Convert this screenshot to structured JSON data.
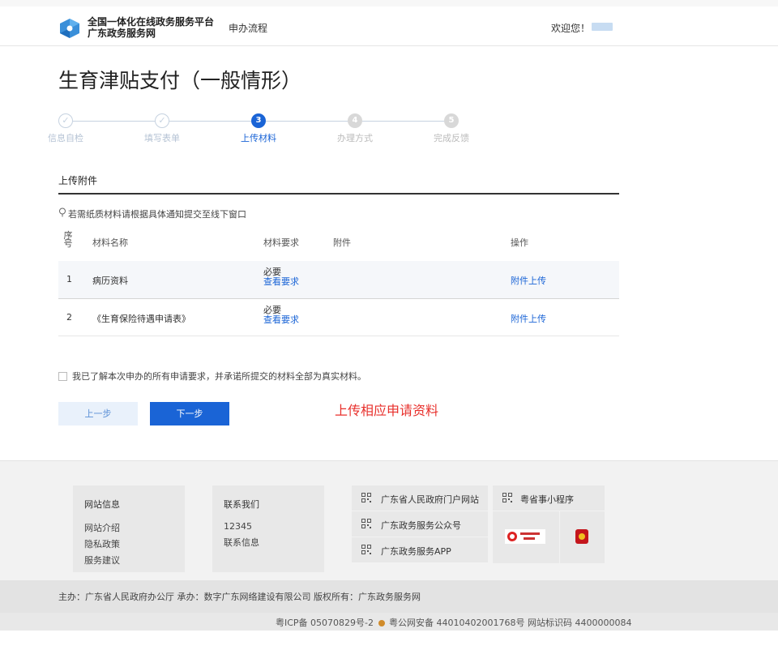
{
  "header": {
    "logo_line1": "全国一体化在线政务服务平台",
    "logo_line2": "广东政务服务网",
    "nav_process": "申办流程",
    "welcome": "欢迎您！"
  },
  "page_title": "生育津贴支付（一般情形）",
  "steps": [
    {
      "label": "信息自检",
      "mark": "✓",
      "state": "done"
    },
    {
      "label": "填写表单",
      "mark": "✓",
      "state": "done"
    },
    {
      "label": "上传材料",
      "mark": "3",
      "state": "current"
    },
    {
      "label": "办理方式",
      "mark": "4",
      "state": "todo"
    },
    {
      "label": "完成反馈",
      "mark": "5",
      "state": "todo"
    }
  ],
  "upload": {
    "section_title": "上传附件",
    "tip": "若需纸质材料请根据具体通知提交至线下窗口",
    "columns": {
      "idx_a": "序",
      "idx_b": "号",
      "name": "材料名称",
      "requirement": "材料要求",
      "attachment": "附件",
      "action": "操作"
    },
    "rows": [
      {
        "idx": "1",
        "name": "病历资料",
        "required": "必要",
        "view": "查看要求",
        "action": "附件上传"
      },
      {
        "idx": "2",
        "name": "《生育保险待遇申请表》",
        "required": "必要",
        "view": "查看要求",
        "action": "附件上传"
      }
    ]
  },
  "agreement": "我已了解本次申办的所有申请要求，并承诺所提交的材料全部为真实材料。",
  "buttons": {
    "prev": "上一步",
    "next": "下一步"
  },
  "annotation": "上传相应申请资料",
  "footer": {
    "site_info": {
      "title": "网站信息",
      "links": [
        "网站介绍",
        "隐私政策",
        "服务建议"
      ]
    },
    "contact": {
      "title": "联系我们",
      "phone": "12345",
      "info": "联系信息"
    },
    "qr_items": [
      "广东省人民政府门户网站",
      "广东政务服务公众号",
      "广东政务服务APP"
    ],
    "mini_program": "粤省事小程序",
    "sponsor_line": "主办：广东省人民政府办公厅    承办：数字广东网络建设有限公司    版权所有：广东政务服务网",
    "icp_part1": "粤ICP备 05070829号-2",
    "icp_part2": "粤公网安备 44010402001768号",
    "icp_part3": "网站标识码 4400000084"
  },
  "colors": {
    "accent": "#1a64d6",
    "annotation": "#e8302c"
  }
}
